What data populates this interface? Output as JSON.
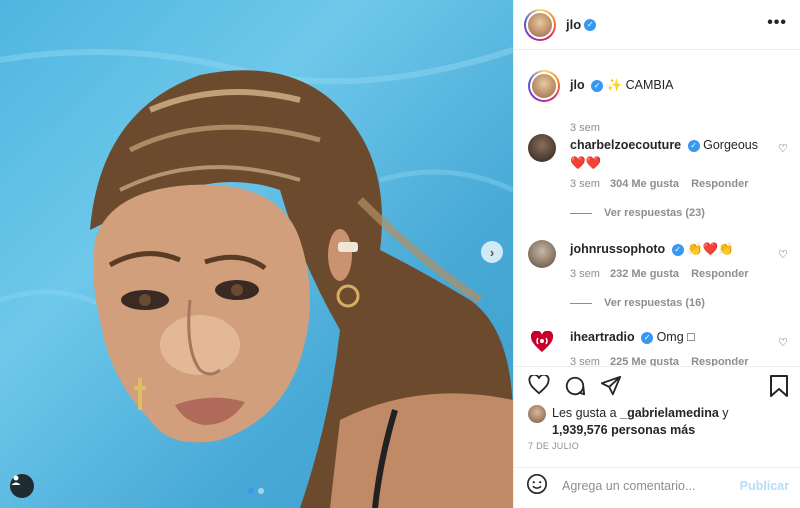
{
  "post": {
    "author": "jlo",
    "caption": "✨ CAMBIA",
    "caption_time": "3 sem",
    "date": "7 DE JULIO",
    "liked_by_prefix": "Les gusta a",
    "liked_by_user": "_gabrielamedina",
    "liked_by_join": "y",
    "likes_count": "1,939,576 personas más",
    "carousel_total": 2,
    "carousel_active": 1
  },
  "header": {
    "username": "jlo",
    "more_label": "•••"
  },
  "comments": [
    {
      "username": "charbelzoecouture",
      "text": "Gorgeous ❤️❤️",
      "time": "3 sem",
      "likes": "304 Me gusta",
      "reply": "Responder",
      "view_replies": "Ver respuestas (23)"
    },
    {
      "username": "johnrussophoto",
      "text": "👏❤️👏",
      "time": "3 sem",
      "likes": "232 Me gusta",
      "reply": "Responder",
      "view_replies": "Ver respuestas (16)"
    },
    {
      "username": "iheartradio",
      "text": "Omg □",
      "time": "3 sem",
      "likes": "225 Me gusta",
      "reply": "Responder"
    }
  ],
  "comment_box": {
    "placeholder": "Agrega un comentario...",
    "publish": "Publicar"
  },
  "colors": {
    "verified": "#3897f0",
    "iheart": "#c6002b",
    "publish_disabled": "#b2dffc"
  },
  "icons": [
    "heart-icon",
    "comment-icon",
    "share-icon",
    "bookmark-icon",
    "emoji-icon",
    "tag-user-icon",
    "chevron-right-icon"
  ]
}
